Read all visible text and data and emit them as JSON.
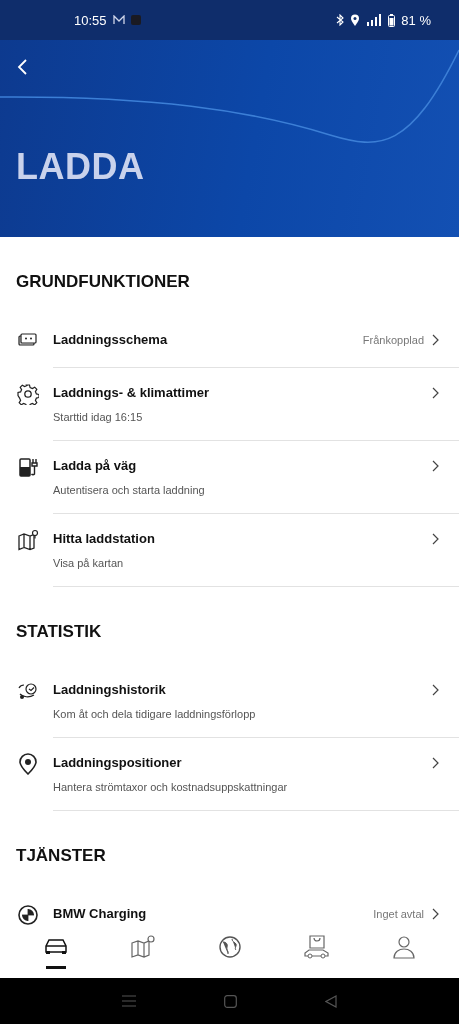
{
  "status_bar": {
    "time": "10:55",
    "battery": "81 %"
  },
  "header": {
    "title": "LADDA"
  },
  "sections": [
    {
      "title": "GRUNDFUNKTIONER",
      "items": [
        {
          "title": "Laddningsschema",
          "value": "Frånkopplad"
        },
        {
          "title": "Laddnings- & klimattimer",
          "subtitle": "Starttid idag 16:15"
        },
        {
          "title": "Ladda på väg",
          "subtitle": "Autentisera och starta laddning"
        },
        {
          "title": "Hitta laddstation",
          "subtitle": "Visa på kartan"
        }
      ]
    },
    {
      "title": "STATISTIK",
      "items": [
        {
          "title": "Laddningshistorik",
          "subtitle": "Kom åt och dela tidigare laddningsförlopp"
        },
        {
          "title": "Laddningspositioner",
          "subtitle": "Hantera strömtaxor och kostnadsuppskattningar"
        }
      ]
    },
    {
      "title": "TJÄNSTER",
      "items": [
        {
          "title": "BMW Charging",
          "value": "Inget avtal"
        }
      ]
    }
  ],
  "bottom_nav": [
    {
      "selected": true
    },
    {
      "selected": false
    },
    {
      "selected": false
    },
    {
      "selected": false
    },
    {
      "selected": false
    }
  ]
}
